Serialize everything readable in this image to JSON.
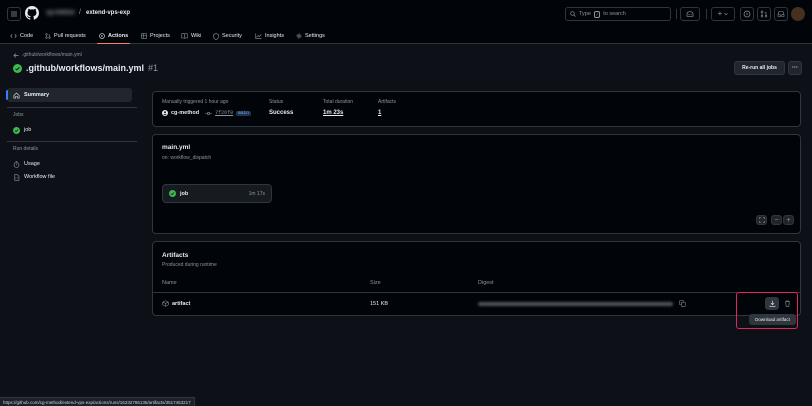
{
  "header": {
    "repo_owner": "cg-method",
    "separator": "/",
    "repo_name": "extend-vps-exp",
    "search_prefix": "Type",
    "search_key": "/",
    "search_suffix": "to search",
    "plus_label": "+"
  },
  "tabs": [
    {
      "label": "Code"
    },
    {
      "label": "Pull requests"
    },
    {
      "label": "Actions"
    },
    {
      "label": "Projects"
    },
    {
      "label": "Wiki"
    },
    {
      "label": "Security"
    },
    {
      "label": "Insights"
    },
    {
      "label": "Settings"
    }
  ],
  "workflow": {
    "back_link": ".github/workflows/main.yml",
    "title": ".github/workflows/main.yml",
    "run_number": "#1",
    "rerun_label": "Re-run all jobs",
    "more_label": "···"
  },
  "sidebar": {
    "summary_label": "Summary",
    "jobs_heading": "Jobs",
    "job_label": "job",
    "run_details_heading": "Run details",
    "usage_label": "Usage",
    "workflow_file_label": "Workflow file"
  },
  "summary": {
    "trigger_text": "Manually triggered 1 hour ago",
    "actor": "cg-method",
    "commit_sha": "7f26f0",
    "branch": "main",
    "status_heading": "Status",
    "status_value": "Success",
    "duration_heading": "Total duration",
    "duration_value": "1m 23s",
    "artifacts_heading": "Artifacts",
    "artifacts_value": "1"
  },
  "graph": {
    "file_name": "main.yml",
    "trigger": "on: workflow_dispatch",
    "job_name": "job",
    "job_duration": "1m 17s",
    "zoom_out": "−",
    "zoom_in": "+"
  },
  "artifacts": {
    "title": "Artifacts",
    "subtitle": "Produced during runtime",
    "columns": [
      "Name",
      "Size",
      "Digest"
    ],
    "rows": [
      {
        "name": "artifact",
        "size": "151 KB"
      }
    ],
    "tooltip": "Download artifact"
  },
  "status_bar_url": "https://github.com/cg-method/extend-vps-exp/actions/runs/16232786135/artifacts/3517453217",
  "colors": {
    "success": "#3fb950",
    "accent_underline": "#f78166",
    "highlight": "#e3245f"
  }
}
